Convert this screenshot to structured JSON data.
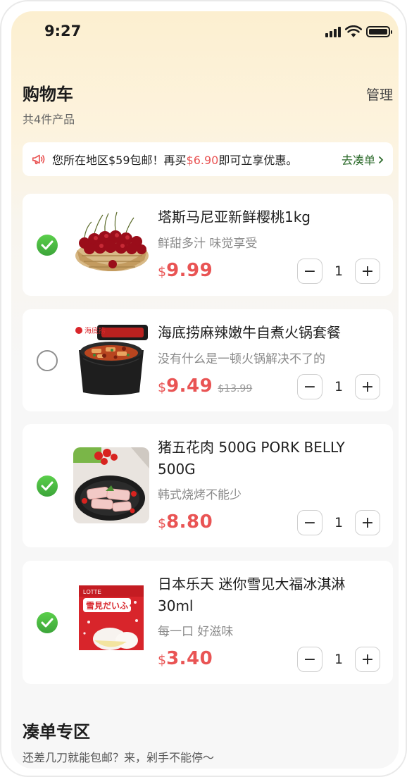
{
  "status_bar": {
    "time": "9:27"
  },
  "header": {
    "title": "购物车",
    "count_text": "共4件产品",
    "manage_label": "管理"
  },
  "notice": {
    "text_before": "您所在地区$59包邮！再买",
    "amount": "$6.90",
    "text_after": "即可立享优惠。",
    "link_label": "去凑单"
  },
  "items": [
    {
      "name": "塔斯马尼亚新鲜樱桃1kg",
      "desc": "鲜甜多汁 味觉享受",
      "currency": "$",
      "price": "9.99",
      "old_price": "",
      "qty": "1",
      "checked": true,
      "image_icon": "cherries-image"
    },
    {
      "name": "海底捞麻辣嫩牛自煮火锅套餐",
      "desc": "没有什么是一顿火锅解决不了的",
      "currency": "$",
      "price": "9.49",
      "old_price": "$13.99",
      "qty": "1",
      "checked": false,
      "image_icon": "hotpot-image"
    },
    {
      "name": "猪五花肉 500G PORK BELLY 500G",
      "desc": "韩式烧烤不能少",
      "currency": "$",
      "price": "8.80",
      "old_price": "",
      "qty": "1",
      "checked": true,
      "image_icon": "pork-belly-image"
    },
    {
      "name": "日本乐天 迷你雪见大福冰淇淋30ml",
      "desc": "每一口 好滋味",
      "currency": "$",
      "price": "3.40",
      "old_price": "",
      "qty": "1",
      "checked": true,
      "image_icon": "mochi-icecream-image"
    }
  ],
  "stepper": {
    "minus": "−",
    "plus": "+"
  },
  "section": {
    "title": "凑单专区",
    "subtitle": "还差几刀就能包邮？来，剁手不能停～"
  },
  "colors": {
    "accent_red": "#e95454",
    "check_green": "#3ca53a",
    "link_green": "#2d6b2c",
    "header_bg": "#fcefd0"
  },
  "product_box_texts": {
    "hotpot_brand": "海底捞",
    "icecream_brand": "LOTTE",
    "icecream_name": "雪見だいふく"
  }
}
